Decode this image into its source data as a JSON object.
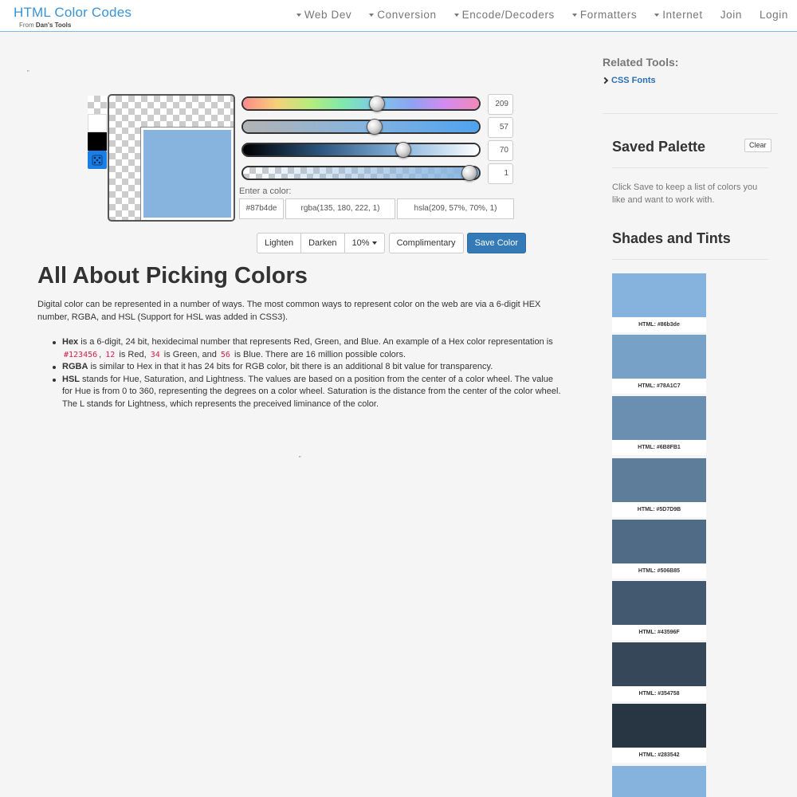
{
  "header": {
    "title": "HTML Color Codes",
    "subtitle_prefix": "From ",
    "subtitle_brand": "Dan's Tools",
    "nav": [
      {
        "label": "Web Dev",
        "dropdown": true
      },
      {
        "label": "Conversion",
        "dropdown": true
      },
      {
        "label": "Encode/Decoders",
        "dropdown": true
      },
      {
        "label": "Formatters",
        "dropdown": true
      },
      {
        "label": "Internet",
        "dropdown": true
      },
      {
        "label": "Join",
        "dropdown": false
      },
      {
        "label": "Login",
        "dropdown": false
      }
    ]
  },
  "picker": {
    "color_hex": "#87b4de",
    "values": {
      "hue": "209",
      "saturation": "57",
      "lightness": "70",
      "alpha": "1"
    },
    "levels": {
      "hue": 0.58,
      "saturation": 0.57,
      "lightness": 0.7,
      "alpha": 1.0
    },
    "enter_label": "Enter a color:",
    "hex_value": "#87b4de",
    "rgba_value": "rgba(135, 180, 222, 1)",
    "hsla_value": "hsla(209, 57%, 70%, 1)",
    "buttons": {
      "lighten": "Lighten",
      "darken": "Darken",
      "step": "10%",
      "complimentary": "Complimentary",
      "save": "Save Color"
    }
  },
  "article": {
    "title": "All About Picking Colors",
    "intro": "Digital color can be represented in a number of ways. The most common ways to represent color on the web are via a 6-digit HEX number, RGBA, and HSL (Support for HSL was added in CSS3).",
    "hex": {
      "term": "Hex",
      "t1": " is a 6-digit, 24 bit, hexidecimal number that represents Red, Green, and Blue. An example of a Hex color representation is ",
      "c1": "#123456",
      "t2": ", ",
      "c2": "12",
      "t3": " is Red, ",
      "c3": "34",
      "t4": " is Green, and ",
      "c4": "56",
      "t5": " is Blue. There are 16 million possible colors."
    },
    "rgba": {
      "term": "RGBA",
      "text": " is similar to Hex in that it has 24 bits for RGB color, bit there is an additional 8 bit value for transparency."
    },
    "hsl": {
      "term": "HSL",
      "text": " stands for Hue, Saturation, and Lightness. The values are based on a position from the center of a color wheel. The value for Hue is from 0 to 360, representing the degrees on a color wheel. Saturation is the distance from the center of the color wheel. The L stands for Lightness, which represents the preceived liminance of the color."
    }
  },
  "sidebar": {
    "related_title": "Related Tools:",
    "related_link": "CSS Fonts",
    "palette_title": "Saved Palette",
    "clear_label": "Clear",
    "palette_help": "Click Save to keep a list of colors you like and want to work with.",
    "shades_title": "Shades and Tints",
    "shades": [
      {
        "label": "HTML: #86b3de",
        "color": "#86b3de"
      },
      {
        "label": "HTML: #78A1C7",
        "color": "#78A1C7"
      },
      {
        "label": "HTML: #6B8FB1",
        "color": "#6B8FB1"
      },
      {
        "label": "HTML: #5D7D9B",
        "color": "#5D7D9B"
      },
      {
        "label": "HTML: #506B85",
        "color": "#506B85"
      },
      {
        "label": "HTML: #43596F",
        "color": "#43596F"
      },
      {
        "label": "HTML: #354758",
        "color": "#354758"
      },
      {
        "label": "HTML: #283542",
        "color": "#283542"
      },
      {
        "color": "#86b3de"
      }
    ]
  }
}
